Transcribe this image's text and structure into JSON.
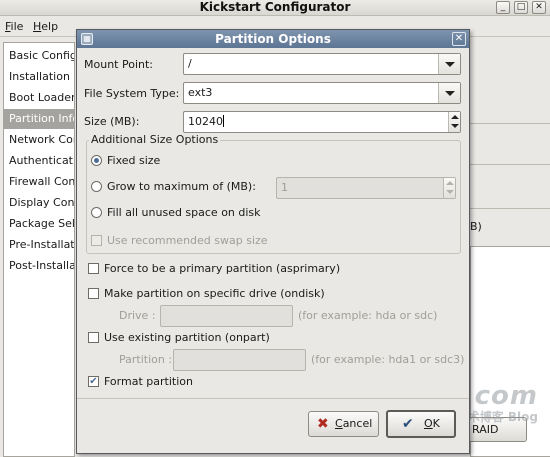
{
  "main_window": {
    "title": "Kickstart Configurator",
    "controls": {
      "minimize": "_",
      "maximize": "□",
      "close": "✕"
    },
    "menu": [
      {
        "label": "File",
        "mnemonic": "F",
        "rest": "ile"
      },
      {
        "label": "Help",
        "mnemonic": "H",
        "rest": "elp"
      }
    ],
    "sidebar": [
      {
        "label": "Basic Configuration",
        "selected": false
      },
      {
        "label": "Installation Method",
        "selected": false
      },
      {
        "label": "Boot Loader Options",
        "selected": false
      },
      {
        "label": "Partition Information",
        "selected": true
      },
      {
        "label": "Network Configuration",
        "selected": false
      },
      {
        "label": "Authentication",
        "selected": false
      },
      {
        "label": "Firewall Configuration",
        "selected": false
      },
      {
        "label": "Display Configuration",
        "selected": false
      },
      {
        "label": "Package Selection",
        "selected": false
      },
      {
        "label": "Pre-Installation Script",
        "selected": false
      },
      {
        "label": "Post-Installation Script",
        "selected": false
      }
    ],
    "right_panel": {
      "partial_text": "B)",
      "raid_button": "RAID"
    },
    "watermark": {
      "big": "51CTO.com",
      "small": "技术博客 Blog"
    }
  },
  "dialog": {
    "title": "Partition Options",
    "icon": "partition-dialog-icon",
    "close_label": "✕",
    "mount_point": {
      "label": "Mount Point:",
      "value": "/"
    },
    "fs_type": {
      "label": "File System Type:",
      "value": "ext3"
    },
    "size": {
      "label": "Size (MB):",
      "value": "10240"
    },
    "additional_size": {
      "title": "Additional Size Options",
      "fixed_size": {
        "label": "Fixed size",
        "selected": true
      },
      "grow_max": {
        "label": "Grow to maximum of (MB):",
        "selected": false,
        "value": "1"
      },
      "fill_all": {
        "label": "Fill all unused space on disk",
        "selected": false
      },
      "recommended_swap": {
        "label": "Use recommended swap size",
        "checked": false,
        "enabled": false
      }
    },
    "force_primary": {
      "label": "Force to be a primary partition (asprimary)",
      "checked": false
    },
    "ondisk": {
      "label": "Make partition on specific drive (ondisk)",
      "checked": false
    },
    "drive": {
      "label": "Drive :",
      "value": "",
      "hint": "(for example: hda or sdc)"
    },
    "onpart": {
      "label": "Use existing partition (onpart)",
      "checked": false
    },
    "partition": {
      "label": "Partition :",
      "value": "",
      "hint": "(for example: hda1 or sdc3)"
    },
    "format": {
      "label": "Format partition",
      "checked": true
    },
    "buttons": {
      "cancel": {
        "label": "Cancel",
        "mnemonic": "C",
        "rest": "ancel",
        "icon": "✖"
      },
      "ok": {
        "label": "OK",
        "mnemonic": "O",
        "rest": "K",
        "icon": "✔"
      }
    }
  },
  "colors": {
    "dialog_title_bar": "#6a82a0",
    "selection": "#a4a3a0",
    "check_accent": "#4d6c96"
  }
}
